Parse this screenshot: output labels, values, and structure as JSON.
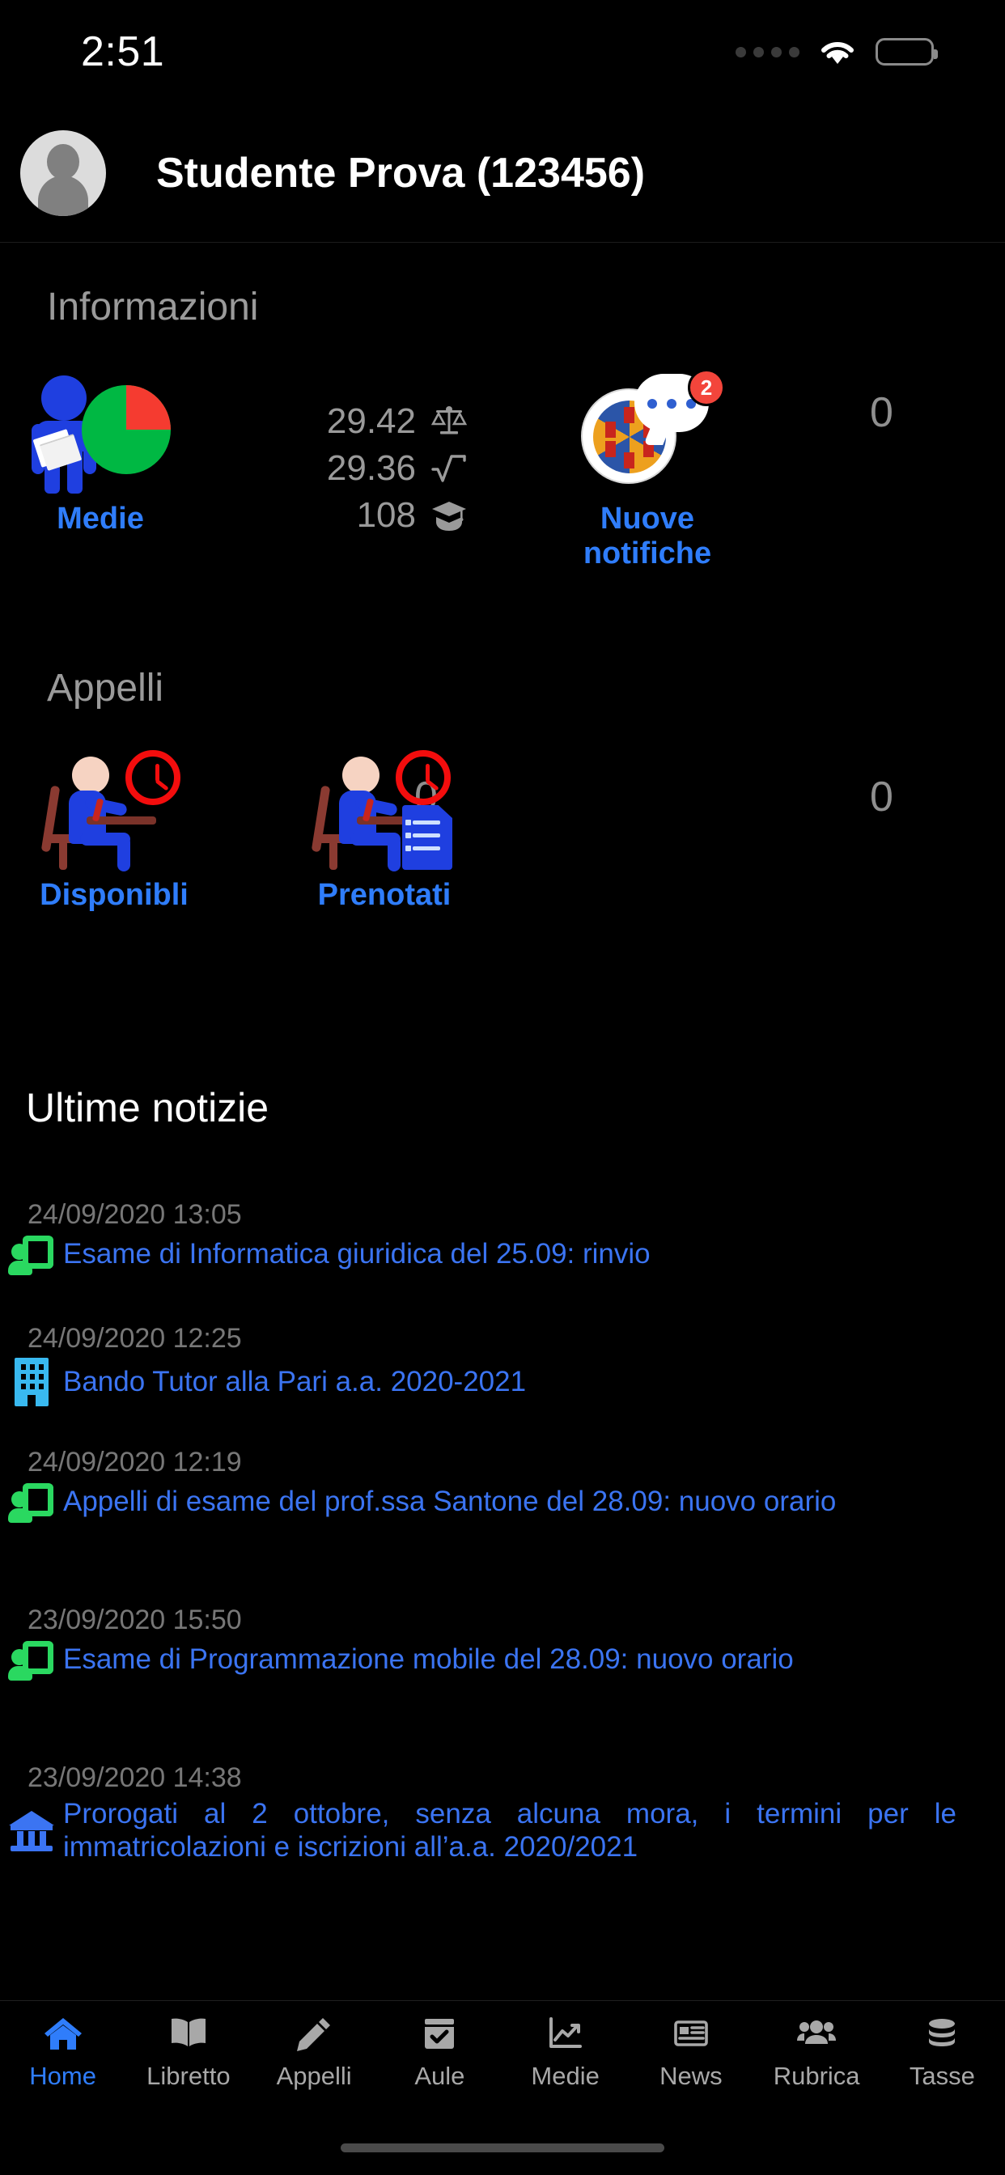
{
  "status_bar": {
    "time": "2:51",
    "signal_icon": "signal-dots-icon",
    "wifi_icon": "wifi-icon",
    "battery_icon": "battery-full-icon"
  },
  "header": {
    "avatar_icon": "avatar-placeholder-icon",
    "title": "Studente Prova (123456)"
  },
  "informazioni": {
    "section_title": "Informazioni",
    "medie": {
      "label": "Medie",
      "icon": "person-pie-chart-icon"
    },
    "stats": [
      {
        "value": "29.42",
        "icon": "balance-scale-icon"
      },
      {
        "value": "29.36",
        "icon": "square-root-icon"
      },
      {
        "value": "108",
        "icon": "graduation-cap-icon"
      }
    ],
    "notifiche": {
      "label": "Nuove notifiche",
      "icon": "university-seal-chat-icon",
      "badge": "2",
      "count": "0"
    }
  },
  "appelli": {
    "section_title": "Appelli",
    "items": [
      {
        "label": "Disponibli",
        "icon": "student-desk-clock-icon",
        "count": "0"
      },
      {
        "label": "Prenotati",
        "icon": "student-desk-clock-document-icon",
        "count": "0"
      }
    ]
  },
  "news": {
    "section_title": "Ultime notizie",
    "items": [
      {
        "date": "24/09/2020 13:05",
        "icon": "teaching-screen-icon",
        "title": "Esame di Informatica giuridica del 25.09: rinvio"
      },
      {
        "date": "24/09/2020 12:25",
        "icon": "building-icon",
        "title": "Bando Tutor alla Pari a.a. 2020-2021"
      },
      {
        "date": "24/09/2020 12:19",
        "icon": "teaching-screen-icon",
        "title": "Appelli di esame del prof.ssa Santone del 28.09: nuovo orario"
      },
      {
        "date": "23/09/2020 15:50",
        "icon": "teaching-screen-icon",
        "title": "Esame di Programmazione mobile del 28.09: nuovo orario"
      },
      {
        "date": "23/09/2020 14:38",
        "icon": "institution-bank-icon",
        "title": "Prorogati al 2 ottobre, senza alcuna mora, i termini per le immatricolazioni e iscrizioni all’a.a. 2020/2021"
      }
    ]
  },
  "tabbar": {
    "items": [
      {
        "label": "Home",
        "icon": "home-icon",
        "active": true
      },
      {
        "label": "Libretto",
        "icon": "book-icon",
        "active": false
      },
      {
        "label": "Appelli",
        "icon": "pencil-icon",
        "active": false
      },
      {
        "label": "Aule",
        "icon": "calendar-check-icon",
        "active": false
      },
      {
        "label": "Medie",
        "icon": "chart-line-icon",
        "active": false
      },
      {
        "label": "News",
        "icon": "newspaper-icon",
        "active": false
      },
      {
        "label": "Rubrica",
        "icon": "people-icon",
        "active": false
      },
      {
        "label": "Tasse",
        "icon": "coins-icon",
        "active": false
      }
    ]
  },
  "colors": {
    "background": "#000000",
    "accent_blue": "#2f7dfb",
    "link_blue": "#3b74f2",
    "muted_grey": "#9a9a9a",
    "badge_red": "#f3453b",
    "news_green": "#2ad860"
  }
}
